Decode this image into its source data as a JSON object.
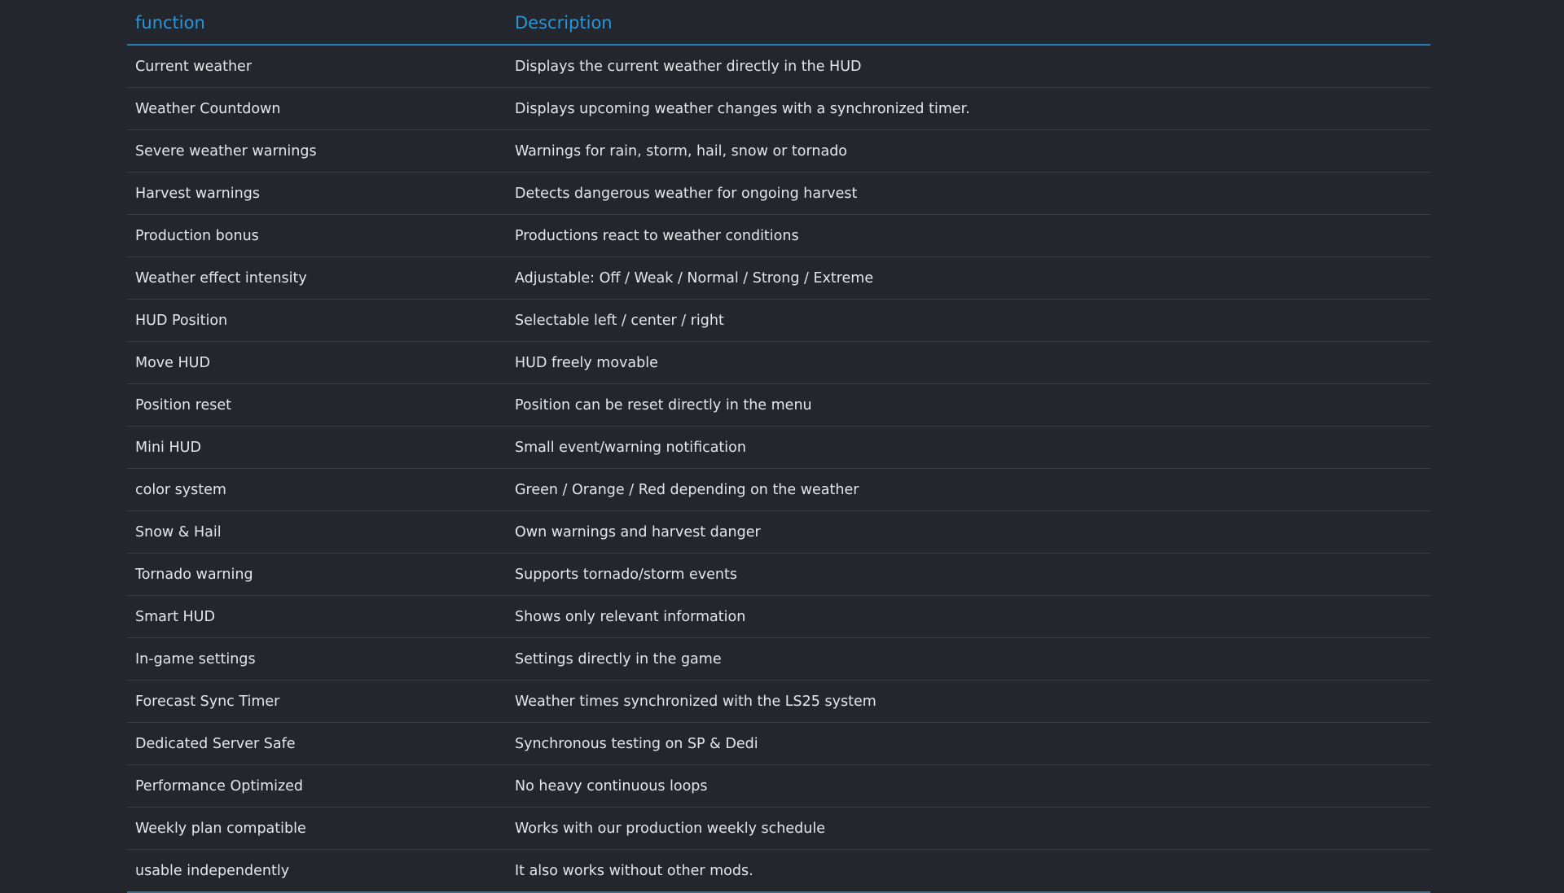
{
  "table": {
    "headers": {
      "function": "function",
      "description": "Description"
    },
    "rows": [
      {
        "function": "Current weather",
        "description": "Displays the current weather directly in the HUD"
      },
      {
        "function": "Weather Countdown",
        "description": "Displays upcoming weather changes with a synchronized timer."
      },
      {
        "function": "Severe weather warnings",
        "description": "Warnings for rain, storm, hail, snow or tornado"
      },
      {
        "function": "Harvest warnings",
        "description": "Detects dangerous weather for ongoing harvest"
      },
      {
        "function": "Production bonus",
        "description": "Productions react to weather conditions"
      },
      {
        "function": "Weather effect intensity",
        "description": "Adjustable: Off / Weak / Normal / Strong / Extreme"
      },
      {
        "function": "HUD Position",
        "description": "Selectable left / center / right"
      },
      {
        "function": "Move HUD",
        "description": "HUD freely movable"
      },
      {
        "function": "Position reset",
        "description": "Position can be reset directly in the menu"
      },
      {
        "function": "Mini HUD",
        "description": "Small event/warning notification"
      },
      {
        "function": "color system",
        "description": "Green / Orange / Red depending on the weather"
      },
      {
        "function": "Snow & Hail",
        "description": "Own warnings and harvest danger"
      },
      {
        "function": "Tornado warning",
        "description": "Supports tornado/storm events"
      },
      {
        "function": "Smart HUD",
        "description": "Shows only relevant information"
      },
      {
        "function": "In-game settings",
        "description": "Settings directly in the game"
      },
      {
        "function": "Forecast Sync Timer",
        "description": "Weather times synchronized with the LS25 system"
      },
      {
        "function": "Dedicated Server Safe",
        "description": "Synchronous testing on SP & Dedi"
      },
      {
        "function": "Performance Optimized",
        "description": "No heavy continuous loops"
      },
      {
        "function": "Weekly plan compatible",
        "description": "Works with our production weekly schedule"
      },
      {
        "function": "usable independently",
        "description": "It also works without other mods."
      }
    ]
  }
}
